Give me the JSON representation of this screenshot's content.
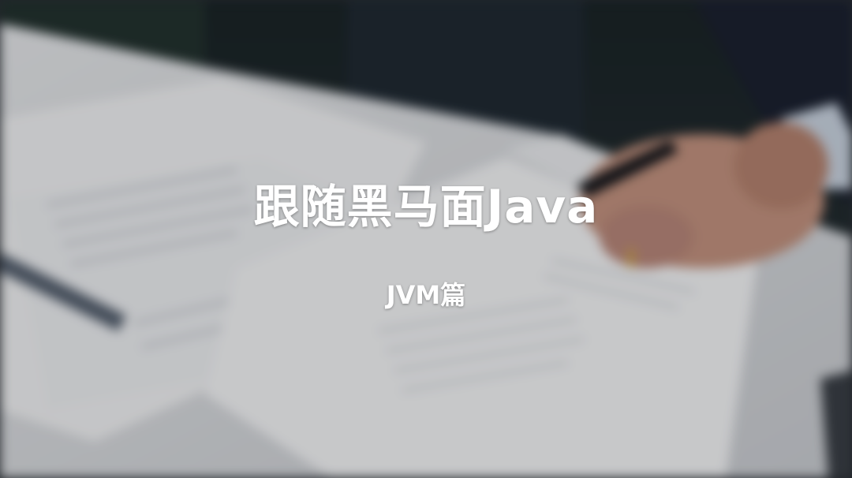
{
  "slide": {
    "title": "跟随黑马面Java",
    "subtitle": "JVM篇"
  },
  "background": {
    "description_colors": {
      "dark_top": "#1f2a2c",
      "paper": "#e9ebee",
      "desk": "#d9dbdf",
      "suit": "#1c2230",
      "skin": "#c99a86"
    }
  }
}
